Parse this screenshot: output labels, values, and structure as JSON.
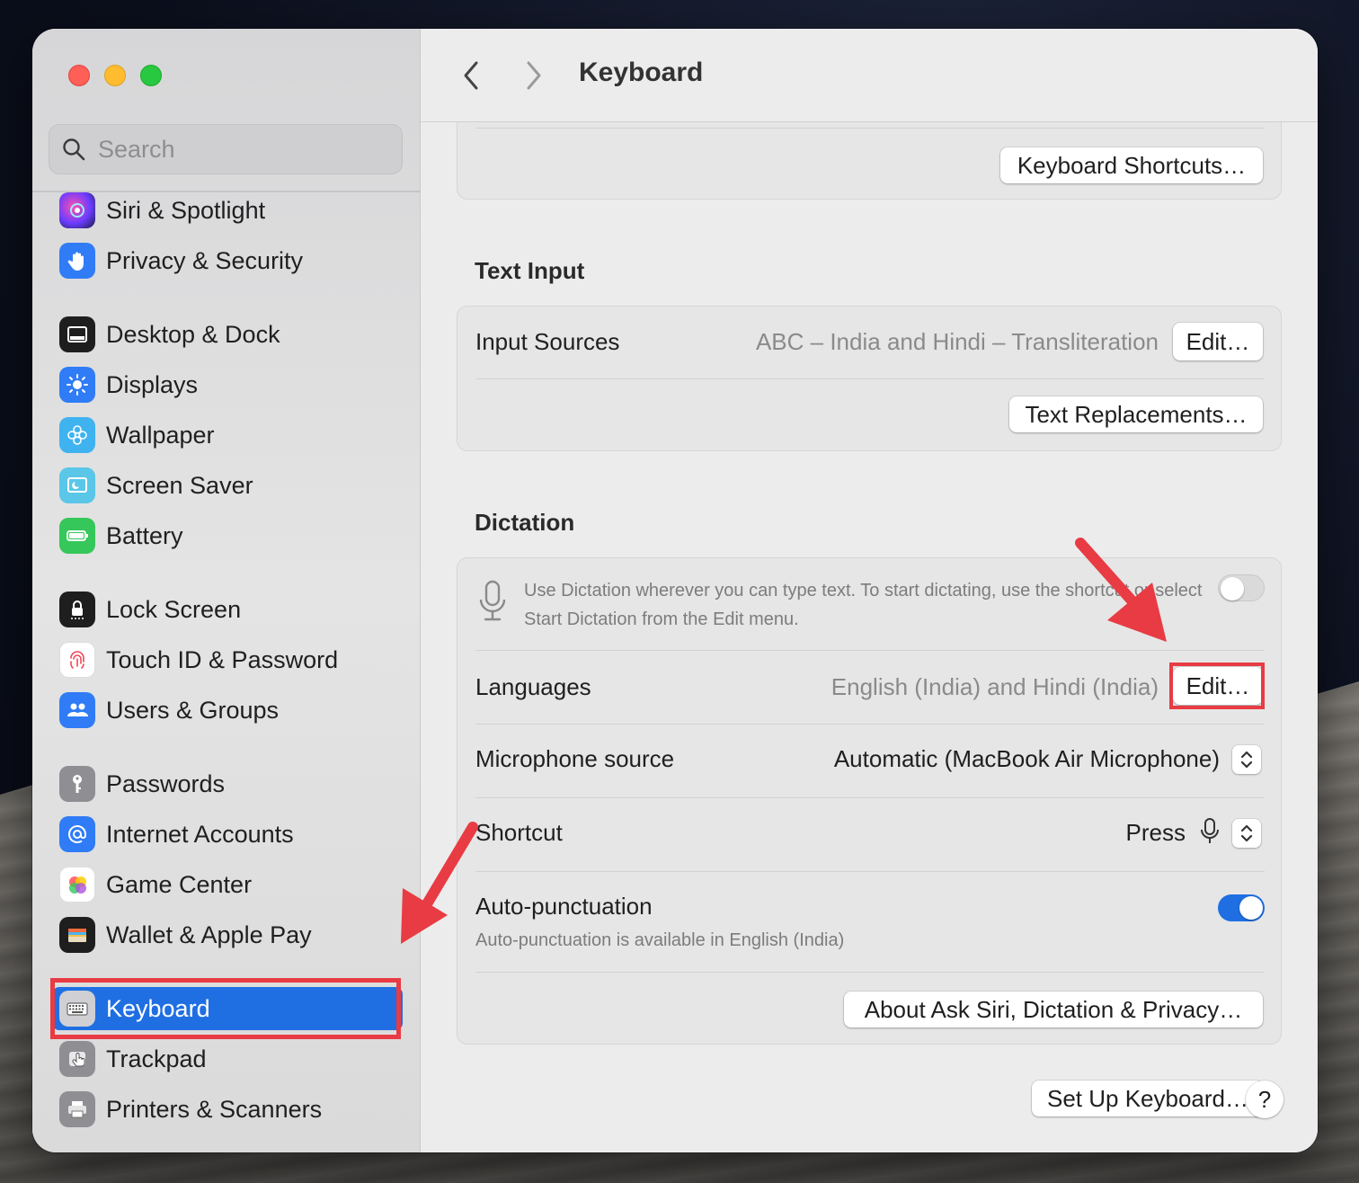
{
  "window": {
    "title": "Keyboard"
  },
  "search": {
    "placeholder": "Search"
  },
  "sidebar": {
    "items": [
      {
        "label": "Siri & Spotlight",
        "icon": "siri-icon"
      },
      {
        "label": "Privacy & Security",
        "icon": "hand-icon"
      },
      {
        "label": "Desktop & Dock",
        "icon": "dock-icon"
      },
      {
        "label": "Displays",
        "icon": "sun-icon"
      },
      {
        "label": "Wallpaper",
        "icon": "flower-icon"
      },
      {
        "label": "Screen Saver",
        "icon": "screen-saver-icon"
      },
      {
        "label": "Battery",
        "icon": "battery-icon"
      },
      {
        "label": "Lock Screen",
        "icon": "lock-icon"
      },
      {
        "label": "Touch ID & Password",
        "icon": "fingerprint-icon"
      },
      {
        "label": "Users & Groups",
        "icon": "users-icon"
      },
      {
        "label": "Passwords",
        "icon": "key-icon"
      },
      {
        "label": "Internet Accounts",
        "icon": "at-icon"
      },
      {
        "label": "Game Center",
        "icon": "game-center-icon"
      },
      {
        "label": "Wallet & Apple Pay",
        "icon": "wallet-icon"
      },
      {
        "label": "Keyboard",
        "icon": "keyboard-icon",
        "selected": true
      },
      {
        "label": "Trackpad",
        "icon": "trackpad-icon"
      },
      {
        "label": "Printers & Scanners",
        "icon": "printer-icon"
      }
    ]
  },
  "main": {
    "keyboard_shortcuts_btn": "Keyboard Shortcuts…",
    "text_input": {
      "title": "Text Input",
      "input_sources_label": "Input Sources",
      "input_sources_value": "ABC – India and Hindi – Transliteration",
      "edit_btn": "Edit…",
      "text_replacements_btn": "Text Replacements…"
    },
    "dictation": {
      "title": "Dictation",
      "description": "Use Dictation wherever you can type text. To start dictating, use the shortcut or select Start Dictation from the Edit menu.",
      "enabled": false,
      "languages_label": "Languages",
      "languages_value": "English (India) and Hindi (India)",
      "languages_edit_btn": "Edit…",
      "mic_label": "Microphone source",
      "mic_value": "Automatic (MacBook Air Microphone)",
      "shortcut_label": "Shortcut",
      "shortcut_value": "Press",
      "autopunct_label": "Auto-punctuation",
      "autopunct_sub": "Auto-punctuation is available in English (India)",
      "autopunct_enabled": true,
      "about_btn": "About Ask Siri, Dictation & Privacy…"
    },
    "setup_keyboard_btn": "Set Up Keyboard…",
    "help_btn": "?"
  },
  "colors": {
    "accent": "#1f6fe3",
    "annotation": "#e83b43"
  }
}
